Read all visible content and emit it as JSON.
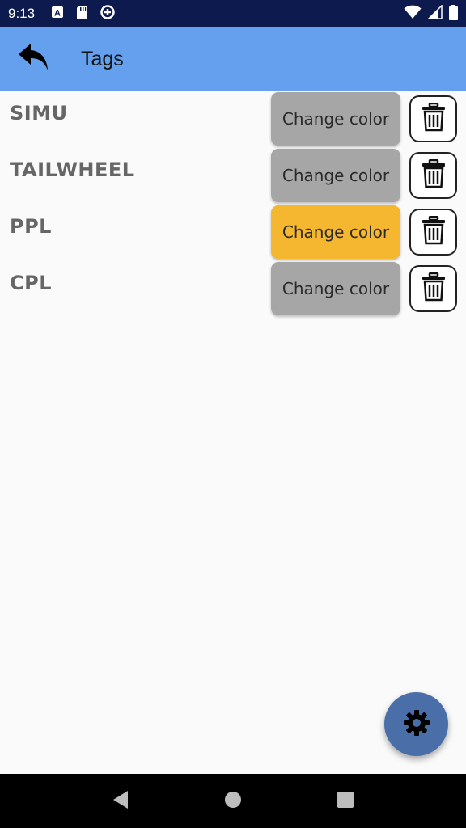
{
  "status_bar": {
    "time": "9:13",
    "icons_left": [
      "a-box-icon",
      "sd-card-icon",
      "data-saver-icon"
    ],
    "icons_right": [
      "wifi-icon",
      "signal-icon",
      "battery-icon"
    ]
  },
  "app_bar": {
    "title": "Tags",
    "back_icon": "reply-arrow-icon"
  },
  "tags": [
    {
      "name": "SIMU",
      "button_label": "Change color",
      "color": "#a6a6a6"
    },
    {
      "name": "TAILWHEEL",
      "button_label": "Change color",
      "color": "#a6a6a6"
    },
    {
      "name": "PPL",
      "button_label": "Change color",
      "color": "#f5b72f"
    },
    {
      "name": "CPL",
      "button_label": "Change color",
      "color": "#a6a6a6"
    }
  ],
  "fab": {
    "icon": "gear-icon"
  },
  "nav_bar": {
    "icons": [
      "back-triangle-icon",
      "home-circle-icon",
      "recents-square-icon"
    ]
  },
  "colors": {
    "status_bar": "#0d1a4e",
    "app_bar": "#64a0ed",
    "fab": "#4a6fa8",
    "tag_text": "#666666"
  }
}
